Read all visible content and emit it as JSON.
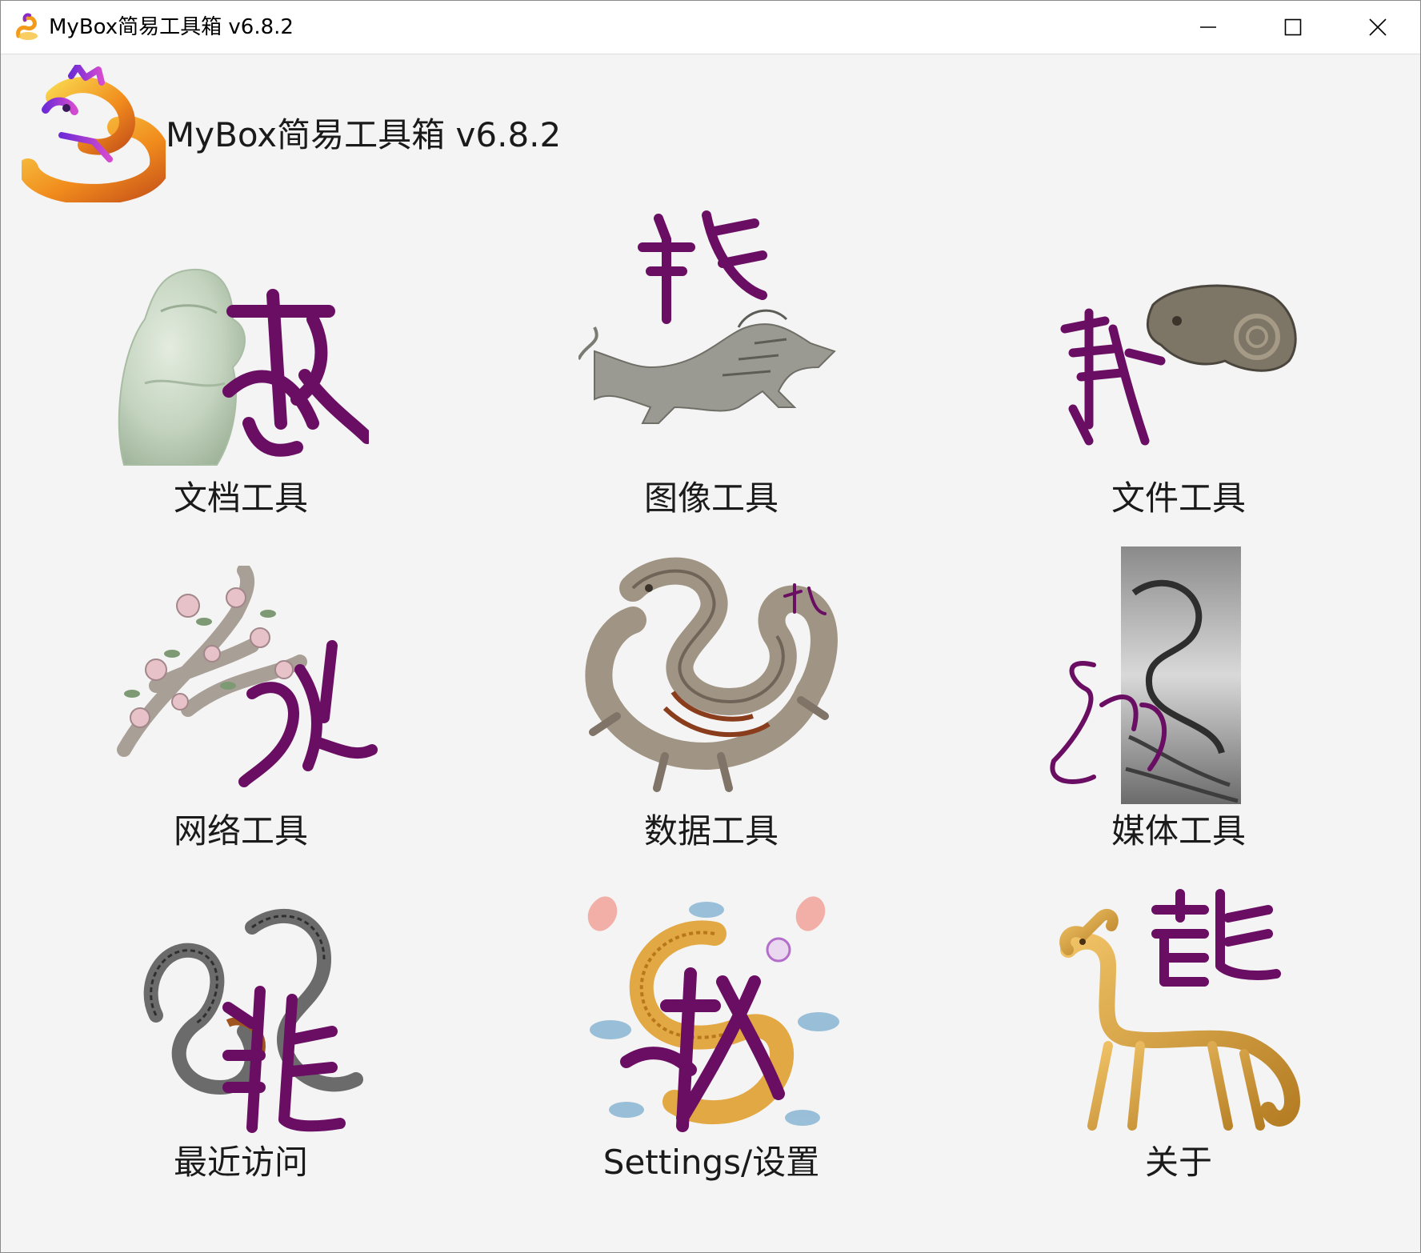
{
  "window": {
    "title": "MyBox简易工具箱 v6.8.2",
    "controls": {
      "minimize_icon": "minimize-icon",
      "maximize_icon": "maximize-icon",
      "close_icon": "close-icon"
    }
  },
  "header": {
    "title": "MyBox简易工具箱 v6.8.2",
    "logo_icon": "dragon-logo-icon"
  },
  "tools": [
    {
      "label": "文档工具",
      "icon": "jade-dragon-icon"
    },
    {
      "label": "图像工具",
      "icon": "stone-dragon-icon"
    },
    {
      "label": "文件工具",
      "icon": "bronze-dragon-head-icon"
    },
    {
      "label": "网络工具",
      "icon": "flower-dragon-icon"
    },
    {
      "label": "数据工具",
      "icon": "coiled-stone-dragon-icon"
    },
    {
      "label": "媒体工具",
      "icon": "ink-painting-dragon-icon"
    },
    {
      "label": "最近访问",
      "icon": "engraved-dragons-icon"
    },
    {
      "label": "Settings/设置",
      "icon": "embroidered-dragon-icon"
    },
    {
      "label": "关于",
      "icon": "golden-dragon-icon"
    }
  ],
  "colors": {
    "background": "#f4f4f4",
    "calligraphy": "#6a0e63",
    "titlebar": "#ffffff",
    "text": "#1a1a1a"
  }
}
